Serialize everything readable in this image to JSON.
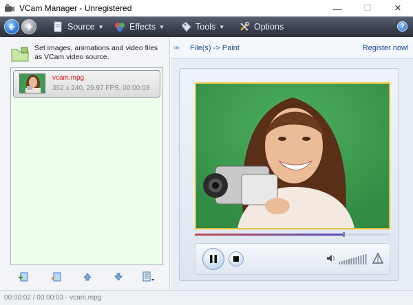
{
  "window": {
    "title": "VCam Manager - Unregistered"
  },
  "toolbar": {
    "menus": [
      {
        "label": "Source",
        "icon": "page-icon"
      },
      {
        "label": "Effects",
        "icon": "effects-icon"
      },
      {
        "label": "Tools",
        "icon": "tag-icon"
      },
      {
        "label": "Options",
        "icon": "tools-icon"
      }
    ],
    "help": "?"
  },
  "left_panel": {
    "hint": "Set images, animations and video files as VCam video source.",
    "items": [
      {
        "name": "vcam.mpg",
        "info": "352 x 240, 29.97 FPS, 00:00:03"
      }
    ]
  },
  "right_panel": {
    "path": "File(s) -> Paint",
    "register": "Register now!",
    "playback_progress": 0.76
  },
  "status": {
    "text": "00:00:02 / 00:00:03 - vcam.mpg"
  },
  "colors": {
    "toolbar": "#3a4150",
    "list_bg": "#efffee",
    "accent_border": "#e6c13c",
    "item_name": "#d42020"
  }
}
